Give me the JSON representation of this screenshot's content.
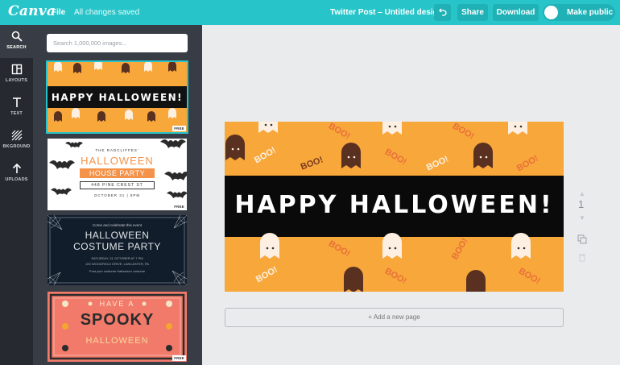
{
  "app": {
    "brand": "Canva"
  },
  "topbar": {
    "file_label": "File",
    "save_status": "All changes saved",
    "doc_title": "Twitter Post – Untitled design",
    "share_label": "Share",
    "download_label": "Download",
    "make_public_label": "Make public",
    "undo_icon": "undo-icon"
  },
  "rail": {
    "items": [
      {
        "label": "SEARCH",
        "icon": "search-icon"
      },
      {
        "label": "LAYOUTS",
        "icon": "layouts-icon"
      },
      {
        "label": "TEXT",
        "icon": "text-icon"
      },
      {
        "label": "BKGROUND",
        "icon": "background-icon"
      },
      {
        "label": "UPLOADS",
        "icon": "upload-icon"
      }
    ]
  },
  "panel": {
    "search_placeholder": "Search 1,000,000 images...",
    "free_label": "FREE",
    "templates": [
      {
        "title": "HAPPY HALLOWEEN!"
      },
      {
        "kicker": "THE RADCLIFFES'",
        "title1": "HALLOWEEN",
        "title2": "HOUSE PARTY",
        "address": "448 PINE CREST ST",
        "date": "OCTOBER 31  |  8PM"
      },
      {
        "kicker": "Come and celebrate this event",
        "title1": "HALLOWEEN",
        "title2": "COSTUME PARTY",
        "details": "SATURDAY, 31 OCTOBER AT 7 PM",
        "details2": "100 WOODFIELD DRIVE, LANCASTER, PA",
        "details3": "Post your costume Halloween costume"
      },
      {
        "line1": "HAVE A",
        "line2": "SPOOKY",
        "line3": "HALLOWEEN"
      }
    ]
  },
  "canvas": {
    "headline": "HAPPY HALLOWEEN!",
    "boo": "BOO!",
    "add_page_label": "+ Add a new page"
  },
  "page_controls": {
    "page_number": "1"
  },
  "colors": {
    "brand_teal": "#27c5c9",
    "rail_dark": "#262a30",
    "panel_dark": "#383d45",
    "halloween_orange": "#f8a73a",
    "ghost_cream": "#fdf0e3",
    "ghost_brown": "#5a3020",
    "boo_orange": "#e8703a",
    "coral": "#f27a6a"
  }
}
